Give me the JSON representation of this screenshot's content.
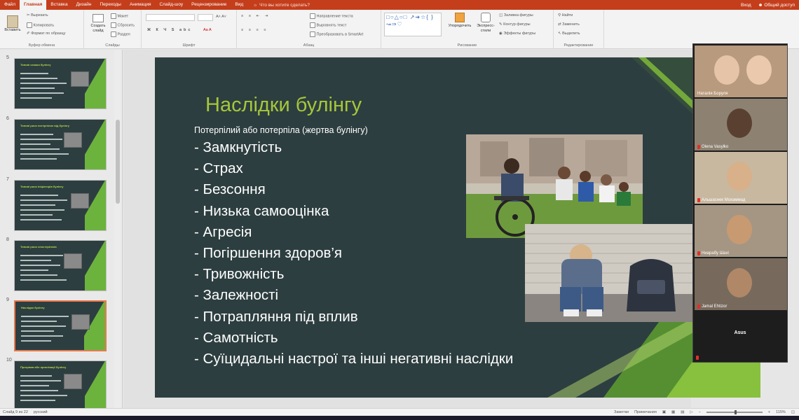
{
  "app": {
    "tabs": [
      "Файл",
      "Главная",
      "Вставка",
      "Дизайн",
      "Переходы",
      "Анимация",
      "Слайд-шоу",
      "Рецензирование",
      "Вид"
    ],
    "active_tab": 1,
    "tell_me": "Что вы хотите сделать?",
    "sign_in": "Вход",
    "share": "Общий доступ",
    "accent_color": "#c43e1c"
  },
  "ribbon": {
    "clipboard": {
      "paste": "Вставить",
      "cut": "Вырезать",
      "copy": "Копировать",
      "format_painter": "Формат по образцу",
      "label": "Буфер обмена"
    },
    "slides": {
      "new_slide": "Создать слайд",
      "layout": "Макет",
      "reset": "Сбросить",
      "section": "Раздел",
      "label": "Слайды"
    },
    "font": {
      "label": "Шрифт"
    },
    "paragraph": {
      "text_direction": "Направление текста",
      "align_text": "Выровнять текст",
      "smartart": "Преобразовать в SmartArt",
      "label": "Абзац"
    },
    "drawing": {
      "arrange": "Упорядочить",
      "quick_styles": "Экспресс-стили",
      "shape_fill": "Заливка фигуры",
      "shape_outline": "Контур фигуры",
      "shape_effects": "Эффекты фигуры",
      "label": "Рисование"
    },
    "editing": {
      "find": "Найти",
      "replace": "Заменить",
      "select": "Выделить",
      "label": "Редактирование"
    }
  },
  "thumbnails": [
    {
      "num": "5",
      "title": "Типові ознаки булінгу"
    },
    {
      "num": "6",
      "title": "Типові риси потерпілих від булінгу"
    },
    {
      "num": "7",
      "title": "Типові риси ініціаторів булінгу"
    },
    {
      "num": "8",
      "title": "Типові риси спостерігачів"
    },
    {
      "num": "9",
      "title": "Наслідки булінгу"
    },
    {
      "num": "10",
      "title": "Програма або організації булінгу"
    }
  ],
  "active_thumbnail": 4,
  "slide": {
    "title": "Наслідки булінгу",
    "subtitle": "Потерпілий або потерпіла (жертва булінгу)",
    "bullets": [
      "- Замкнутість",
      "- Страх",
      "- Безсоння",
      "- Низька самооцінка",
      "- Агресія",
      "- Погіршення здоров’я",
      "- Тривожність",
      "- Залежності",
      "- Потрапляння під вплив",
      "- Самотність",
      "- Суїцидальні настрої та інші негативні наслідки"
    ],
    "title_color": "#a6c73a",
    "background_color": "#2d3e40"
  },
  "participants": [
    {
      "name": "Наталія Боруля"
    },
    {
      "name": "Olena Vasylko"
    },
    {
      "name": "Альшаснек Мохаммад"
    },
    {
      "name": "Ниарабу Шахі"
    },
    {
      "name": "Jamal Ehtizor"
    },
    {
      "name": "Asus"
    }
  ],
  "status": {
    "slide_info": "Слайд 9 из 22",
    "language": "русский",
    "notes": "Заметки",
    "comments": "Примечания",
    "zoom": "115%"
  }
}
